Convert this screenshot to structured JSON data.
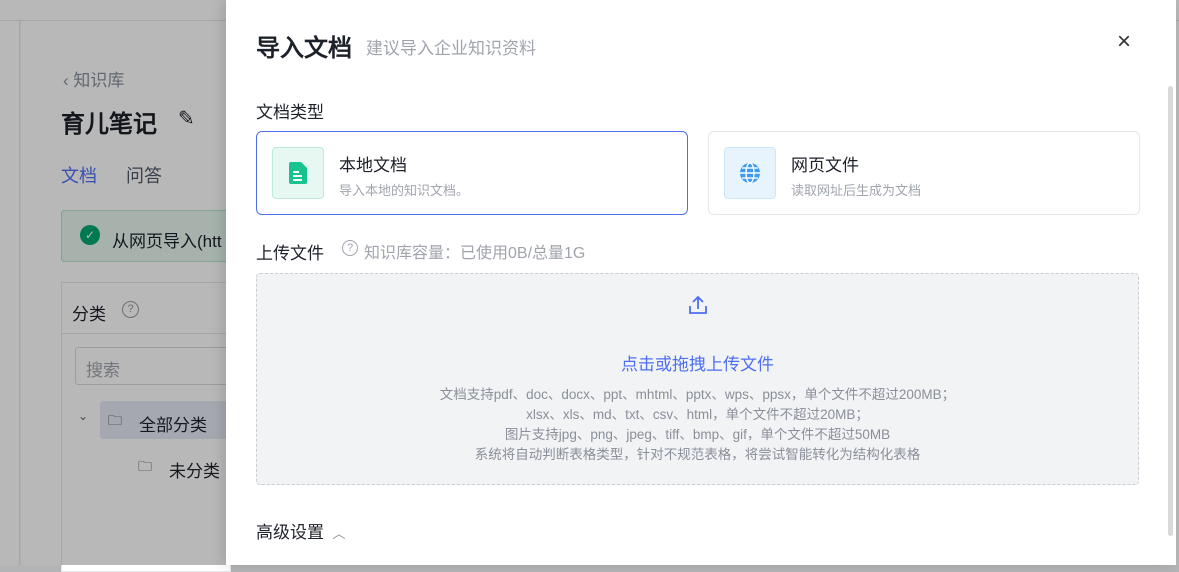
{
  "background": {
    "back_link": "知识库",
    "kb_title": "育儿笔记",
    "tabs": [
      "文档",
      "问答"
    ],
    "toast": "从网页导入(htt",
    "category_label": "分类",
    "search_placeholder": "搜索",
    "tree": [
      "全部分类",
      "未分类"
    ]
  },
  "drawer": {
    "title": "导入文档",
    "subtitle": "建议导入企业知识资料",
    "doc_type_label": "文档类型",
    "types": [
      {
        "title": "本地文档",
        "desc": "导入本地的知识文档。",
        "icon": "file-icon",
        "selected": true
      },
      {
        "title": "网页文件",
        "desc": "读取网址后生成为文档",
        "icon": "globe-icon",
        "selected": false
      }
    ],
    "upload_label": "上传文件",
    "capacity": "知识库容量：已使用0B/总量1G",
    "upload_cta": "点击或拖拽上传文件",
    "hints": [
      "文档支持pdf、doc、docx、ppt、mhtml、pptx、wps、ppsx，单个文件不超过200MB；",
      "xlsx、xls、md、txt、csv、html，单个文件不超过20MB；",
      "图片支持jpg、png、jpeg、tiff、bmp、gif，单个文件不超过50MB",
      "系统将自动判断表格类型，针对不规范表格，将尝试智能转化为结构化表格"
    ],
    "advanced": "高级设置"
  },
  "colors": {
    "accent": "#4e6ef2",
    "green": "#17c38f"
  }
}
